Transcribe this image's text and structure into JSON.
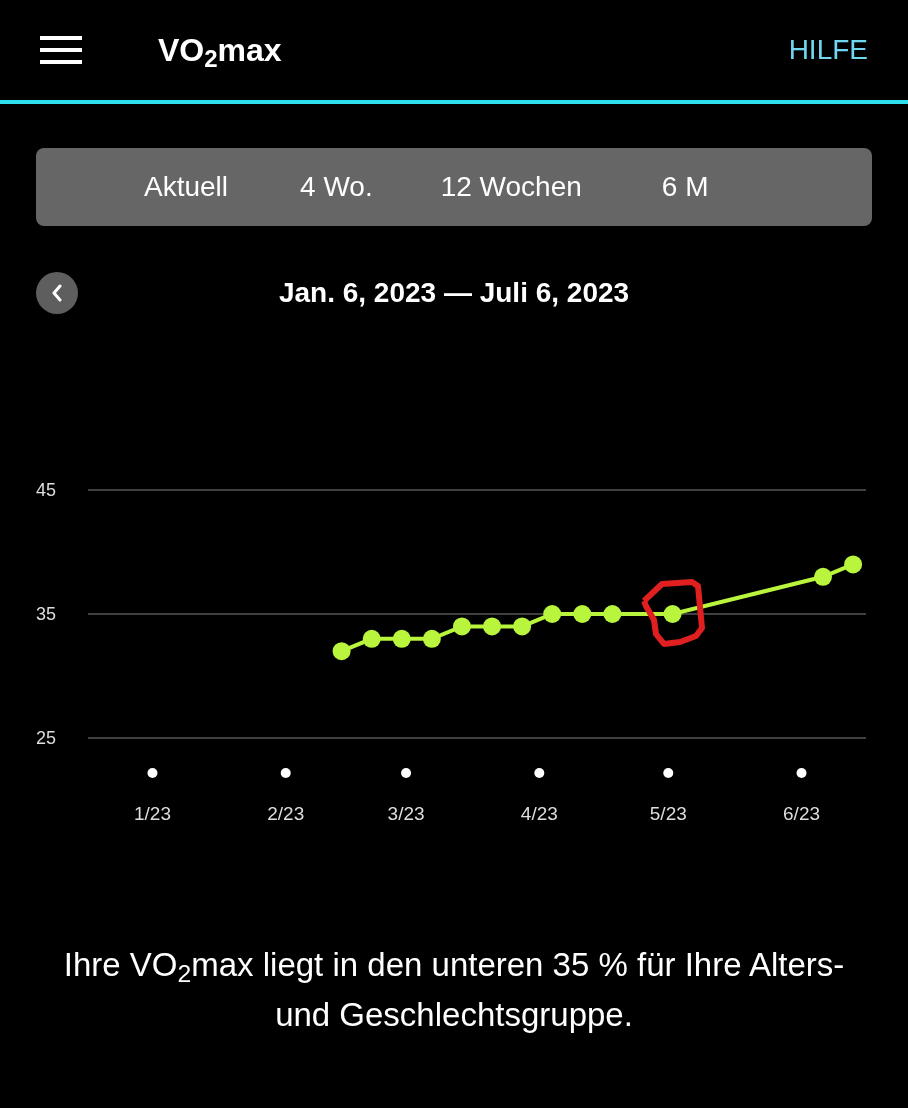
{
  "header": {
    "title": "VO$_{2}$max",
    "help": "HILFE"
  },
  "periods": [
    {
      "label": "Aktuell"
    },
    {
      "label": "4 Wo."
    },
    {
      "label": "12 Wochen"
    },
    {
      "label": "6 M"
    }
  ],
  "date_range": "Jan. 6, 2023 — Juli 6, 2023",
  "chart": {
    "chart_data": {
      "type": "line",
      "x": [
        "2023-02-14",
        "2023-02-21",
        "2023-02-28",
        "2023-03-07",
        "2023-03-14",
        "2023-03-21",
        "2023-03-28",
        "2023-04-04",
        "2023-04-11",
        "2023-04-18",
        "2023-05-02",
        "2023-06-06",
        "2023-06-13"
      ],
      "series": [
        {
          "color": "#b8f53c",
          "marker": "circle",
          "values": [
            32,
            33,
            33,
            33,
            34,
            34,
            34,
            35,
            35,
            35,
            35,
            38,
            39
          ]
        }
      ],
      "ylim": [
        25,
        45
      ],
      "yticks": [
        25,
        35,
        45
      ],
      "xticks": [
        {
          "value": "2023-01-01",
          "label": "1/23"
        },
        {
          "value": "2023-02-01",
          "label": "2/23"
        },
        {
          "value": "2023-03-01",
          "label": "3/23"
        },
        {
          "value": "2023-04-01",
          "label": "4/23"
        },
        {
          "value": "2023-05-01",
          "label": "5/23"
        },
        {
          "value": "2023-06-01",
          "label": "6/23"
        }
      ],
      "xlim": [
        "2022-12-17",
        "2023-06-16"
      ]
    },
    "markup": [
      {
        "kind": "hand-drawn-loop",
        "color": "#e02020"
      }
    ]
  },
  "summary": "Ihre VO$_{2}$max liegt in den unteren 35 % für Ihre Alters- und Geschlechtsgruppe."
}
